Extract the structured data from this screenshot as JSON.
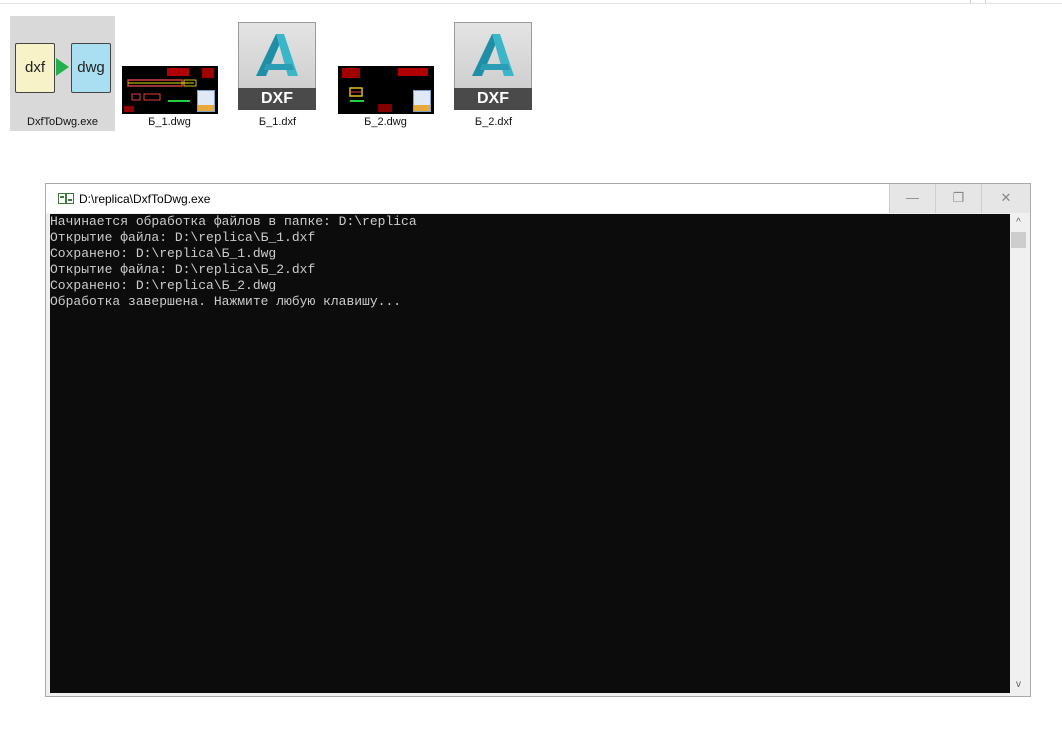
{
  "desktop": {
    "files": [
      {
        "name": "DxfToDwg.exe",
        "selected": true,
        "icon": "dxf-to-dwg-converter-icon",
        "left_badge": "dxf",
        "right_badge": "dwg"
      },
      {
        "name": "Б_1.dwg",
        "icon": "dwg-thumbnail-icon"
      },
      {
        "name": "Б_1.dxf",
        "icon": "autocad-dxf-icon",
        "badge": "DXF"
      },
      {
        "name": "Б_2.dwg",
        "icon": "dwg-thumbnail-icon"
      },
      {
        "name": "Б_2.dxf",
        "icon": "autocad-dxf-icon",
        "badge": "DXF"
      }
    ]
  },
  "console": {
    "title": "D:\\replica\\DxfToDwg.exe",
    "lines": [
      "Начинается обработка файлов в папке: D:\\replica",
      "Открытие файла: D:\\replica\\Б_1.dxf",
      "Сохранено: D:\\replica\\Б_1.dwg",
      "Открытие файла: D:\\replica\\Б_2.dxf",
      "Сохранено: D:\\replica\\Б_2.dwg",
      "Обработка завершена. Нажмите любую клавишу..."
    ],
    "controls": {
      "minimize": "—",
      "maximize": "❐",
      "close": "✕"
    },
    "scroll_up": "^",
    "scroll_down": "v"
  },
  "colors": {
    "console_bg": "#0c0c0c",
    "console_text": "#cccccc",
    "selection": "#d9d9d9",
    "arrow": "#22b14c"
  }
}
